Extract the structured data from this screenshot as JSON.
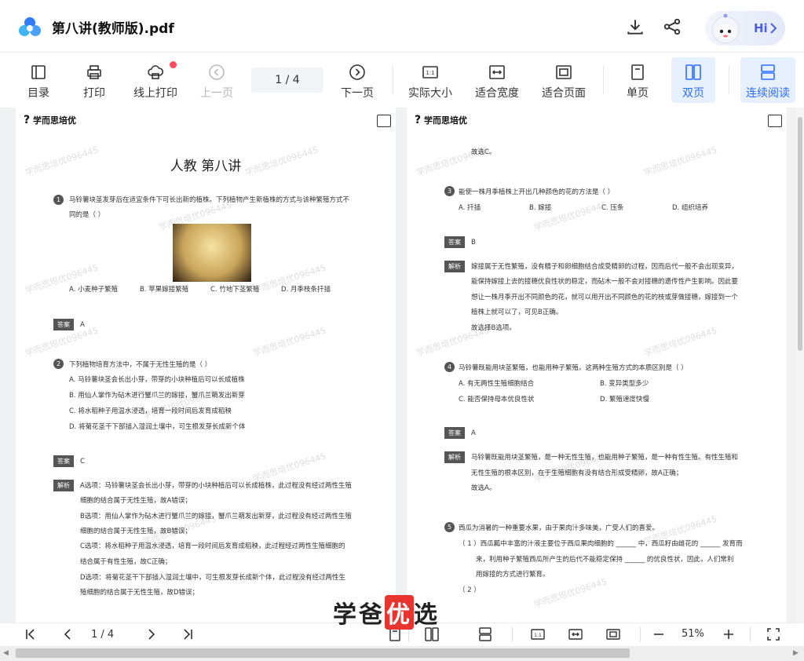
{
  "header": {
    "title": "第八讲(教师版).pdf",
    "hi_label": "Hi"
  },
  "toolbar": {
    "buttons": [
      {
        "label": "目录",
        "icon": "toc-icon"
      },
      {
        "label": "打印",
        "icon": "printer-icon"
      },
      {
        "label": "线上打印",
        "icon": "cloud-print-icon"
      },
      {
        "label": "上一页",
        "icon": "prev-page-icon"
      },
      {
        "label": "下一页",
        "icon": "next-page-icon"
      },
      {
        "label": "实际大小",
        "icon": "actual-size-icon"
      },
      {
        "label": "适合宽度",
        "icon": "fit-width-icon"
      },
      {
        "label": "适合页面",
        "icon": "fit-page-icon"
      },
      {
        "label": "单页",
        "icon": "single-page-icon"
      },
      {
        "label": "双页",
        "icon": "double-page-icon"
      },
      {
        "label": "连续阅读",
        "icon": "continuous-icon"
      }
    ],
    "page_indicator": "1 / 4"
  },
  "document": {
    "brand": "学而思培优",
    "watermark": "学而思培优096445",
    "page1": {
      "title": "人教 第八讲",
      "q1": {
        "num": "1",
        "stem1": "马铃薯块茎发芽后在适宜条件下可长出新的植株。下列植物产生新植株的方式与该种繁殖方式不",
        "stem2": "同的是（     ）",
        "options": [
          "A. 小麦种子繁殖",
          "B. 苹果嫁接繁殖",
          "C. 竹地下茎繁殖",
          "D. 月季枝条扦插"
        ],
        "answer_tag": "答案",
        "answer": "A"
      },
      "q2": {
        "num": "2",
        "stem": "下列植物培育方法中，不属于无性生殖的是（     ）",
        "options": [
          "A. 马铃薯块茎会长出小芽，带芽的小块种植后可以长成植株",
          "B. 用仙人掌作为砧木进行蟹爪兰的嫁接，蟹爪兰萌发出新芽",
          "C. 将水稻种子用温水浸透，培育一段时间后发育成稻秧",
          "D. 将菊花茎干下部插入湿润土壤中，可生根发芽长成新个体"
        ],
        "answer_tag": "答案",
        "answer": "C",
        "analysis_tag": "解析",
        "analysis": [
          "A选项：马铃薯块茎会长出小芽，带芽的小块种植后可以长成植株，此过程没有经过两性生殖",
          "细胞的结合属于无性生殖，故A错误；",
          "B选项：用仙人掌作为砧木进行蟹爪兰的嫁接，蟹爪兰萌发出新芽，此过程没有经过两性生殖",
          "细胞的结合属于无性生殖，故B错误；",
          "C选项：将水稻种子用温水浸透，培育一段时间后发育成稻秧，此过程经过两性生殖细胞的",
          "结合属于有性生殖，故C正确；",
          "D选项：将菊花茎干下部插入湿润土壤中，可生根发芽长成新个体，此过程没有经过两性生",
          "殖细胞的结合属于无性生殖，故D错误；"
        ]
      }
    },
    "page2": {
      "lead": "故选C。",
      "q3": {
        "num": "3",
        "stem": "能使一株月季植株上开出几种颜色的花的方法是（     ）",
        "options": [
          "A. 扦插",
          "B. 嫁接",
          "C. 压条",
          "D. 组织培养"
        ],
        "answer_tag": "答案",
        "answer": "B",
        "analysis_tag": "解析",
        "analysis": [
          "嫁接属于无性繁殖，没有精子和卵细胞结合成受精卵的过程，因而后代一般不会出现变异，",
          "能保持嫁接上去的接穗优良性状的稳定，而砧木一般不会对接穗的遗传性产生影响。因此要",
          "想让一株月季开出不同颜色的花，就可以用开出不同颜色的花的枝或芽做接穗，嫁接到一个",
          "植株上就可以了，可见B正确。",
          "故选择B选项。"
        ]
      },
      "q4": {
        "num": "4",
        "stem": "马铃薯既能用块茎繁殖，也能用种子繁殖。这两种生殖方式的本质区别是（     ）",
        "options": [
          "A. 有无两性生殖细胞结合",
          "B. 变异类型多少",
          "C. 能否保持母本优良性状",
          "D. 繁殖速度快慢"
        ],
        "answer_tag": "答案",
        "answer": "A",
        "analysis_tag": "解析",
        "analysis": [
          "马铃薯既能用块茎繁殖，是一种无性生殖，也能用种子繁殖，是一种有性生殖。有性生殖和",
          "无性生殖的根本区别，在于生殖细胞有没有结合形成受精卵，故A正确；",
          "故选A。"
        ]
      },
      "q5": {
        "num": "5",
        "stem": "西瓜为消暑的一种重要水果，由于果肉汁多味美，广受人们的喜爱。",
        "sub1_a": "（ 1 ）西瓜瓤中丰富的汁液主要位于西瓜果肉细胞的 ______ 中，西瓜籽由雌花的 ______ 发育而",
        "sub1_b": "来，利用种子繁殖西瓜所产生的后代不能稳定保持 ______ 的优良性状，因此，人们常利",
        "sub1_c": "用嫁接的方式进行繁育。",
        "sub2": "（ 2 ）"
      }
    }
  },
  "bottom_bar": {
    "page_indicator": "1 / 4",
    "zoom": "51%",
    "zoom_out": "−",
    "zoom_in": "+"
  },
  "overlay_logo": {
    "pre": "学爸",
    "mid": "优",
    "post": "选"
  }
}
